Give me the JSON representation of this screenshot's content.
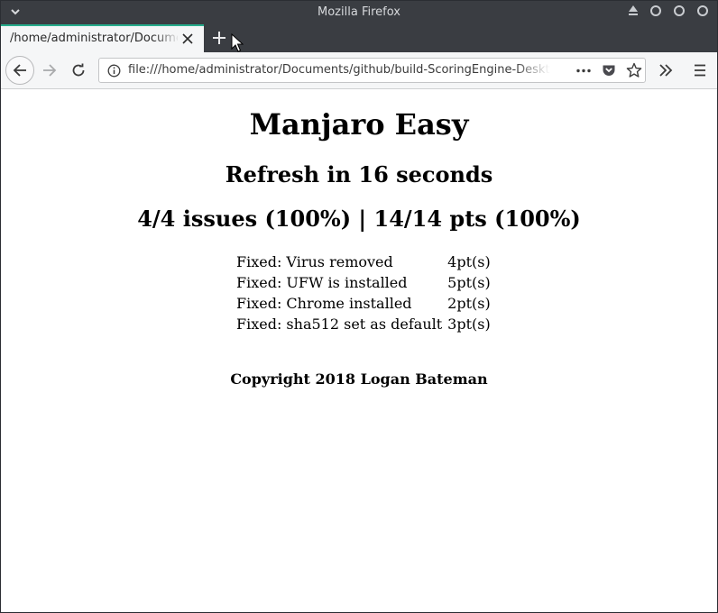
{
  "window": {
    "title": "Mozilla Firefox"
  },
  "tab": {
    "label": "/home/administrator/Documents/github/build-ScoringEngine-Desktop"
  },
  "urlbar": {
    "value": "file:///home/administrator/Documents/github/build-ScoringEngine-Desktop"
  },
  "page": {
    "title": "Manjaro Easy",
    "refresh": "Refresh in 16 seconds",
    "summary": "4/4 issues (100%) | 14/14 pts (100%)",
    "issues": [
      {
        "description": "Fixed: Virus removed",
        "points": "4pt(s)"
      },
      {
        "description": "Fixed: UFW is installed",
        "points": "5pt(s)"
      },
      {
        "description": "Fixed: Chrome installed",
        "points": "2pt(s)"
      },
      {
        "description": "Fixed: sha512 set as default",
        "points": "3pt(s)"
      }
    ],
    "copyright": "Copyright 2018 Logan Bateman"
  },
  "colors": {
    "tab_accent": "#27ad8c",
    "titlebar": "#3a3d42",
    "toolbar": "#f5f6f7"
  }
}
